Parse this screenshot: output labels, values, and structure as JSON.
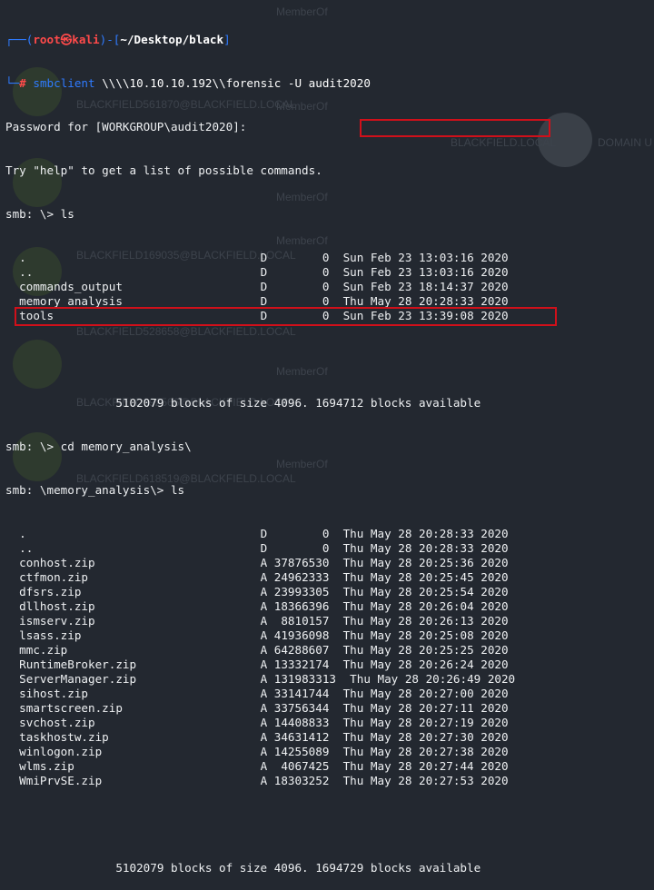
{
  "prompt": {
    "corner": "┌──(",
    "user": "root㉿kali",
    "mid": ")-[",
    "path": "~/Desktop/black",
    "end": "]",
    "corner2": "└─",
    "hash": "#",
    "command_bin": "smbclient",
    "command_args": "\\\\\\\\10.10.10.192\\\\forensic -U audit2020"
  },
  "output": {
    "password_prompt": "Password for [WORKGROUP\\audit2020]:",
    "help_hint": "Try \"help\" to get a list of possible commands.",
    "cmd1": "smb: \\> ls",
    "listing1": [
      {
        "name": ".",
        "attr": "D",
        "size": "0",
        "date": "Sun Feb 23 13:03:16 2020"
      },
      {
        "name": "..",
        "attr": "D",
        "size": "0",
        "date": "Sun Feb 23 13:03:16 2020"
      },
      {
        "name": "commands_output",
        "attr": "D",
        "size": "0",
        "date": "Sun Feb 23 18:14:37 2020"
      },
      {
        "name": "memory_analysis",
        "attr": "D",
        "size": "0",
        "date": "Thu May 28 20:28:33 2020"
      },
      {
        "name": "tools",
        "attr": "D",
        "size": "0",
        "date": "Sun Feb 23 13:39:08 2020"
      }
    ],
    "blocks1": "5102079 blocks of size 4096. 1694712 blocks available",
    "cmd2": "smb: \\> cd memory_analysis\\",
    "cmd3": "smb: \\memory_analysis\\> ls",
    "listing2": [
      {
        "name": ".",
        "attr": "D",
        "size": "0",
        "date": "Thu May 28 20:28:33 2020"
      },
      {
        "name": "..",
        "attr": "D",
        "size": "0",
        "date": "Thu May 28 20:28:33 2020"
      },
      {
        "name": "conhost.zip",
        "attr": "A",
        "size": "37876530",
        "date": "Thu May 28 20:25:36 2020"
      },
      {
        "name": "ctfmon.zip",
        "attr": "A",
        "size": "24962333",
        "date": "Thu May 28 20:25:45 2020"
      },
      {
        "name": "dfsrs.zip",
        "attr": "A",
        "size": "23993305",
        "date": "Thu May 28 20:25:54 2020"
      },
      {
        "name": "dllhost.zip",
        "attr": "A",
        "size": "18366396",
        "date": "Thu May 28 20:26:04 2020"
      },
      {
        "name": "ismserv.zip",
        "attr": "A",
        "size": "8810157",
        "date": "Thu May 28 20:26:13 2020"
      },
      {
        "name": "lsass.zip",
        "attr": "A",
        "size": "41936098",
        "date": "Thu May 28 20:25:08 2020"
      },
      {
        "name": "mmc.zip",
        "attr": "A",
        "size": "64288607",
        "date": "Thu May 28 20:25:25 2020"
      },
      {
        "name": "RuntimeBroker.zip",
        "attr": "A",
        "size": "13332174",
        "date": "Thu May 28 20:26:24 2020"
      },
      {
        "name": "ServerManager.zip",
        "attr": "A",
        "size": "131983313",
        "date": "Thu May 28 20:26:49 2020"
      },
      {
        "name": "sihost.zip",
        "attr": "A",
        "size": "33141744",
        "date": "Thu May 28 20:27:00 2020"
      },
      {
        "name": "smartscreen.zip",
        "attr": "A",
        "size": "33756344",
        "date": "Thu May 28 20:27:11 2020"
      },
      {
        "name": "svchost.zip",
        "attr": "A",
        "size": "14408833",
        "date": "Thu May 28 20:27:19 2020"
      },
      {
        "name": "taskhostw.zip",
        "attr": "A",
        "size": "34631412",
        "date": "Thu May 28 20:27:30 2020"
      },
      {
        "name": "winlogon.zip",
        "attr": "A",
        "size": "14255089",
        "date": "Thu May 28 20:27:38 2020"
      },
      {
        "name": "wlms.zip",
        "attr": "A",
        "size": "4067425",
        "date": "Thu May 28 20:27:44 2020"
      },
      {
        "name": "WmiPrvSE.zip",
        "attr": "A",
        "size": "18303252",
        "date": "Thu May 28 20:27:53 2020"
      }
    ],
    "blocks2": "5102079 blocks of size 4096. 1694729 blocks available"
  },
  "background": {
    "labels": [
      "MemberOf",
      "BLACKFIELD561870@BLACKFIELD.LOCAL",
      "MemberOf",
      "BLACKFIELD.LOCAL",
      "DOMAIN U",
      "MemberOf",
      "MemberOf",
      "BLACKFIELD169035@BLACKFIELD.LOCAL",
      "BLACKFIELD528658@BLACKFIELD.LOCAL",
      "MemberOf",
      "BLACKFIELD992566@BLACKFIELD.LOCAL",
      "MemberOf",
      "BLACKFIELD618519@BLACKFIELD.LOCAL"
    ]
  },
  "colors": {
    "terminal_bg": "#232830",
    "prompt_blue": "#2f7bff",
    "prompt_red": "#ff4a4a",
    "highlight_red": "#d0101a"
  }
}
